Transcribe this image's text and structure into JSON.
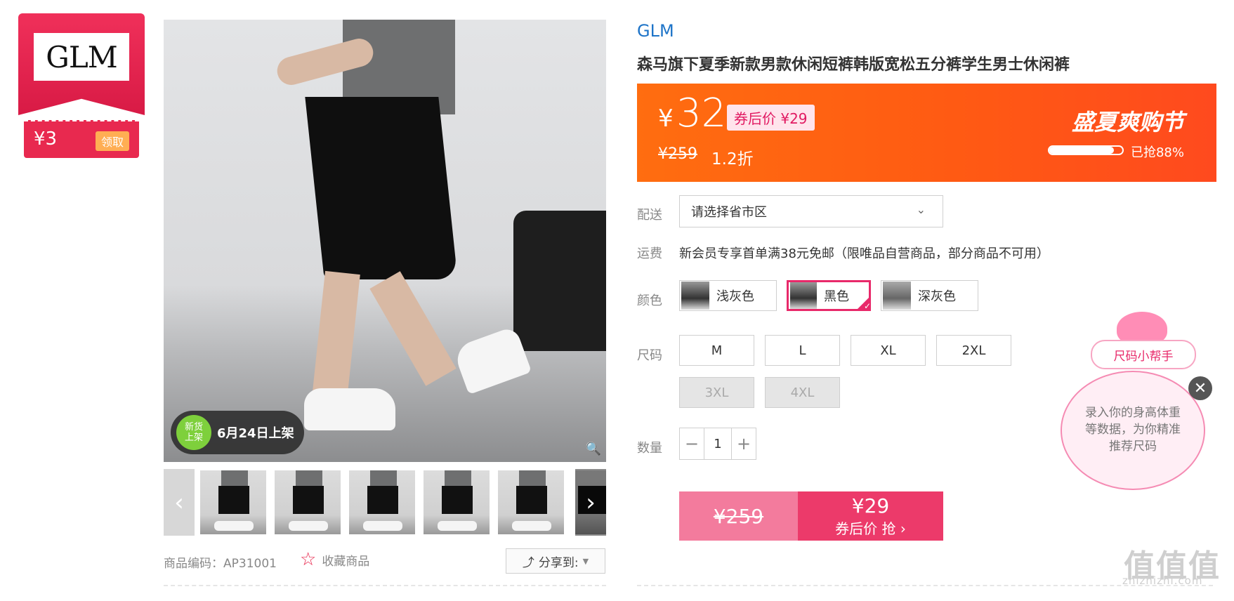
{
  "shop": {
    "logo_text": "GLM",
    "coupon_amount": "¥3",
    "coupon_action": "领取"
  },
  "gallery": {
    "new_badge": "新货\n上架",
    "new_text": "6月24日上架",
    "prev_icon": "chevron-left-icon",
    "next_icon": "chevron-right-icon"
  },
  "meta": {
    "product_code": "商品编码：AP31001",
    "favorite": "收藏商品",
    "share": "分享到:"
  },
  "product": {
    "brand": "GLM",
    "title": "森马旗下夏季新款男款休闲短裤韩版宽松五分裤学生男士休闲裤"
  },
  "price": {
    "currency": "¥",
    "current": "32",
    "coupon_price": "券后价 ¥29",
    "original": "¥259",
    "discount": "1.2折",
    "festival": "盛夏爽购节",
    "sold_label": "已抢88%",
    "sold_fraction": 0.88
  },
  "shipping": {
    "label": "配送",
    "placeholder": "请选择省市区"
  },
  "fee": {
    "label": "运费",
    "text": "新会员专享首单满38元免邮（限唯品自营商品，部分商品不可用）"
  },
  "colors": {
    "label": "颜色",
    "options": [
      "浅灰色",
      "黑色",
      "深灰色"
    ],
    "selected": "黑色"
  },
  "sizes": {
    "label": "尺码",
    "options": [
      "M",
      "L",
      "XL",
      "2XL",
      "3XL",
      "4XL"
    ],
    "disabled": [
      "3XL",
      "4XL"
    ]
  },
  "quantity": {
    "label": "数量",
    "value": "1",
    "minus": "−",
    "plus": "+"
  },
  "buy": {
    "original": "¥259",
    "price": "¥29",
    "action": "券后价 抢 ›"
  },
  "helper": {
    "tag": "尺码小帮手",
    "text": "录入你的身高体重等数据，为你精准推荐尺码"
  },
  "watermark": {
    "logo": "值值值",
    "site": "zhizhizhi.com"
  },
  "colors_theme": {
    "accent": "#e8296a",
    "brand_blue": "#1e74c8",
    "price_bar": "#ff5a13"
  }
}
